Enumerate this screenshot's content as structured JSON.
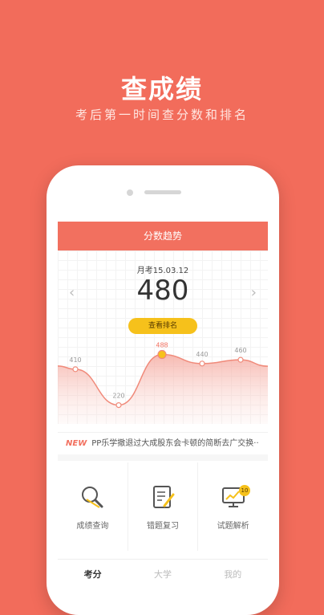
{
  "promo": {
    "title": "查成绩",
    "subtitle": "考后第一时间查分数和排名"
  },
  "app": {
    "header_title": "分数趋势",
    "exam_date": "月考15.03.12",
    "score": "480",
    "rank_button": "查看排名",
    "nav_prev": "‹",
    "nav_next": "›"
  },
  "chart_data": {
    "type": "line",
    "values": [
      410,
      220,
      488,
      440,
      460
    ],
    "labels": [
      "410",
      "220",
      "488",
      "440",
      "460"
    ],
    "highlight_index": 2,
    "title": "",
    "xlabel": "",
    "ylabel": ""
  },
  "news": {
    "badge": "NEW",
    "text": "PP乐学撤退过大成股东会卡顿的简断去广交换··"
  },
  "features": [
    {
      "label": "成绩查询",
      "icon": "magnifier-icon"
    },
    {
      "label": "错题复习",
      "icon": "notebook-pen-icon"
    },
    {
      "label": "试题解析",
      "icon": "monitor-chart-icon",
      "badge": "10"
    }
  ],
  "tabs": [
    {
      "label": "考分",
      "active": true
    },
    {
      "label": "大学",
      "active": false
    },
    {
      "label": "我的",
      "active": false
    }
  ],
  "colors": {
    "background": "#f26c5b",
    "header": "#f2705f",
    "accent_yellow": "#f6c11b"
  }
}
